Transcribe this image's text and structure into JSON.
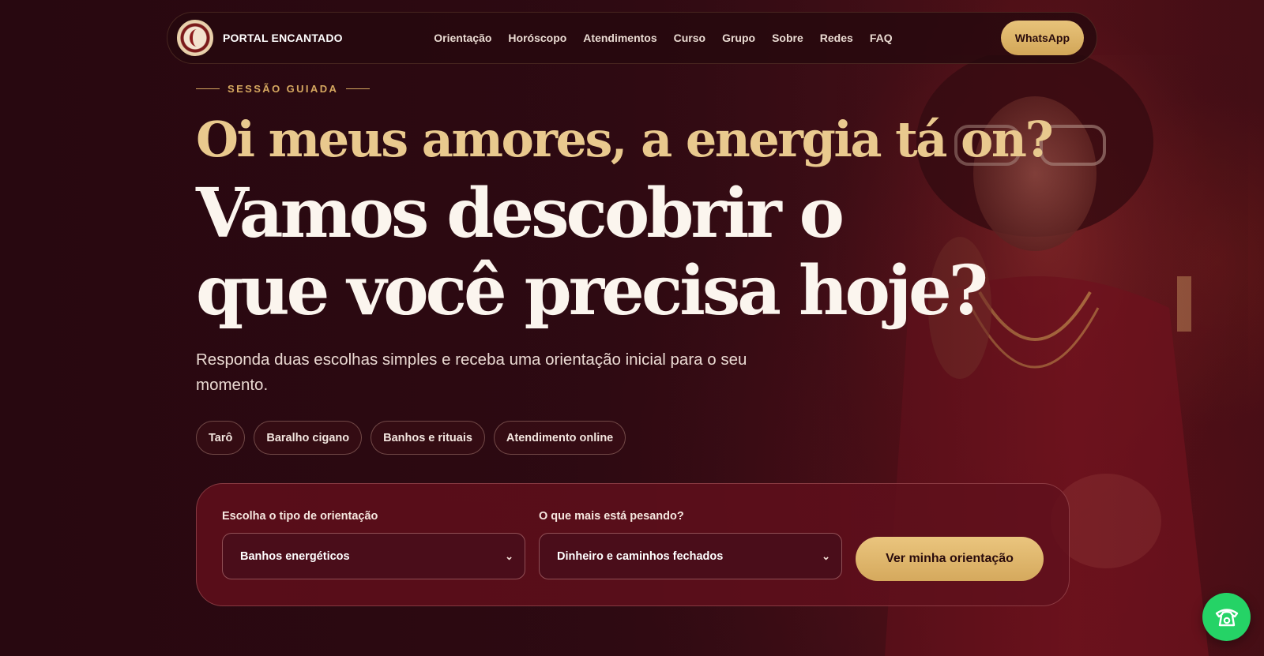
{
  "header": {
    "brand": "PORTAL ENCANTADO",
    "menu": [
      "Orientação",
      "Horóscopo",
      "Atendimentos",
      "Curso",
      "Grupo",
      "Sobre",
      "Redes",
      "FAQ"
    ],
    "cta_label": "WhatsApp"
  },
  "hero": {
    "eyebrow": "SESSÃO GUIADA",
    "subtitle": "Oi meus amores, a energia tá on?",
    "title": "Vamos descobrir o que você precisa hoje?",
    "lead": "Responda duas escolhas simples e receba uma orientação inicial para o seu momento.",
    "chips": [
      "Tarô",
      "Baralho cigano",
      "Banhos e rituais",
      "Atendimento online"
    ]
  },
  "form": {
    "type_label": "Escolha o tipo de orientação",
    "type_value": "Banhos energéticos",
    "concern_label": "O que mais está pesando?",
    "concern_value": "Dinheiro e caminhos fechados",
    "submit_label": "Ver minha orientação"
  },
  "icons": {
    "logo": "crescent-moon-logo",
    "floating": "phone-icon",
    "select_arrow": "chevron-down-icon"
  },
  "colors": {
    "gold": "#e9c98e",
    "background": "#2a0a12",
    "fab_green": "#25d366"
  }
}
